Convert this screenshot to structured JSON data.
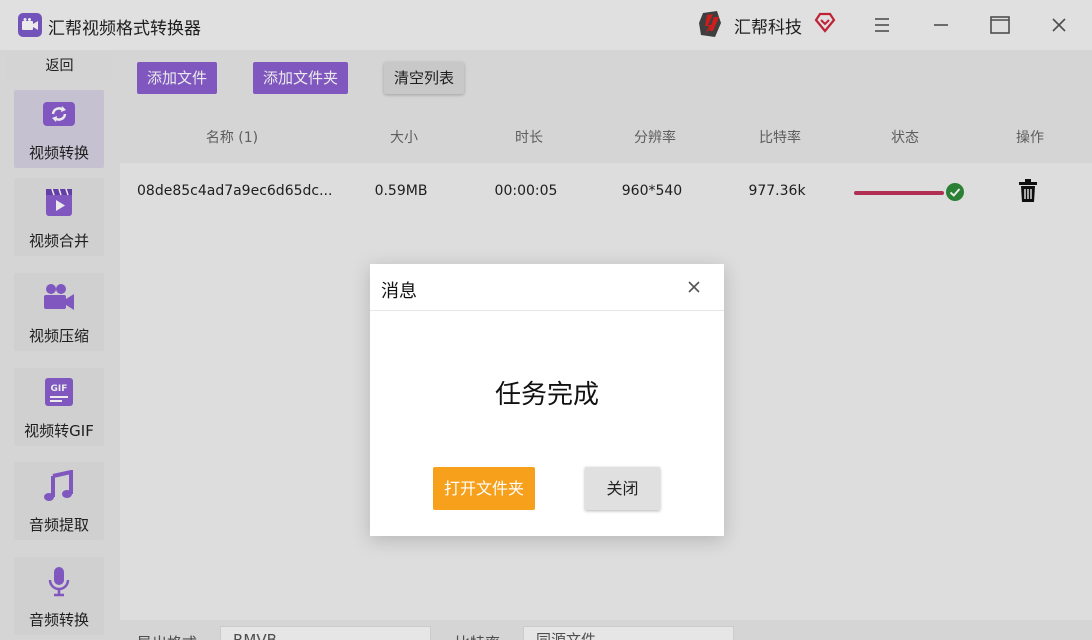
{
  "app": {
    "title": "汇帮视频格式转换器"
  },
  "brand": {
    "name": "汇帮科技"
  },
  "sidebar": {
    "back_label": "返回",
    "items": [
      {
        "label": "视频转换",
        "icon": "video-convert-icon",
        "active": true
      },
      {
        "label": "视频合并",
        "icon": "video-merge-icon",
        "active": false
      },
      {
        "label": "视频压缩",
        "icon": "video-compress-icon",
        "active": false
      },
      {
        "label": "视频转GIF",
        "icon": "gif-icon",
        "active": false
      },
      {
        "label": "音频提取",
        "icon": "music-note-icon",
        "active": false
      },
      {
        "label": "音频转换",
        "icon": "microphone-icon",
        "active": false
      }
    ]
  },
  "toolbar": {
    "add_file": "添加文件",
    "add_folder": "添加文件夹",
    "clear_list": "清空列表"
  },
  "table": {
    "headers": {
      "name": "名称 (1)",
      "size": "大小",
      "duration": "时长",
      "resolution": "分辨率",
      "bitrate": "比特率",
      "status": "状态",
      "action": "操作"
    },
    "rows": [
      {
        "name": "08de85c4ad7a9ec6d65dc...",
        "size": "0.59MB",
        "duration": "00:00:05",
        "resolution": "960*540",
        "bitrate": "977.36k",
        "progress": 1.0
      }
    ]
  },
  "bottom": {
    "format_label": "导出格式",
    "format_value": "RMVB",
    "bitrate_label": "比特率",
    "bitrate_value": "同源文件"
  },
  "modal": {
    "title": "消息",
    "message": "任务完成",
    "open_folder": "打开文件夹",
    "close": "关闭"
  },
  "colors": {
    "accent_purple": "#8a5fd0",
    "orange": "#f7a01b",
    "progress": "#c0335a",
    "success": "#2e8b3a"
  }
}
